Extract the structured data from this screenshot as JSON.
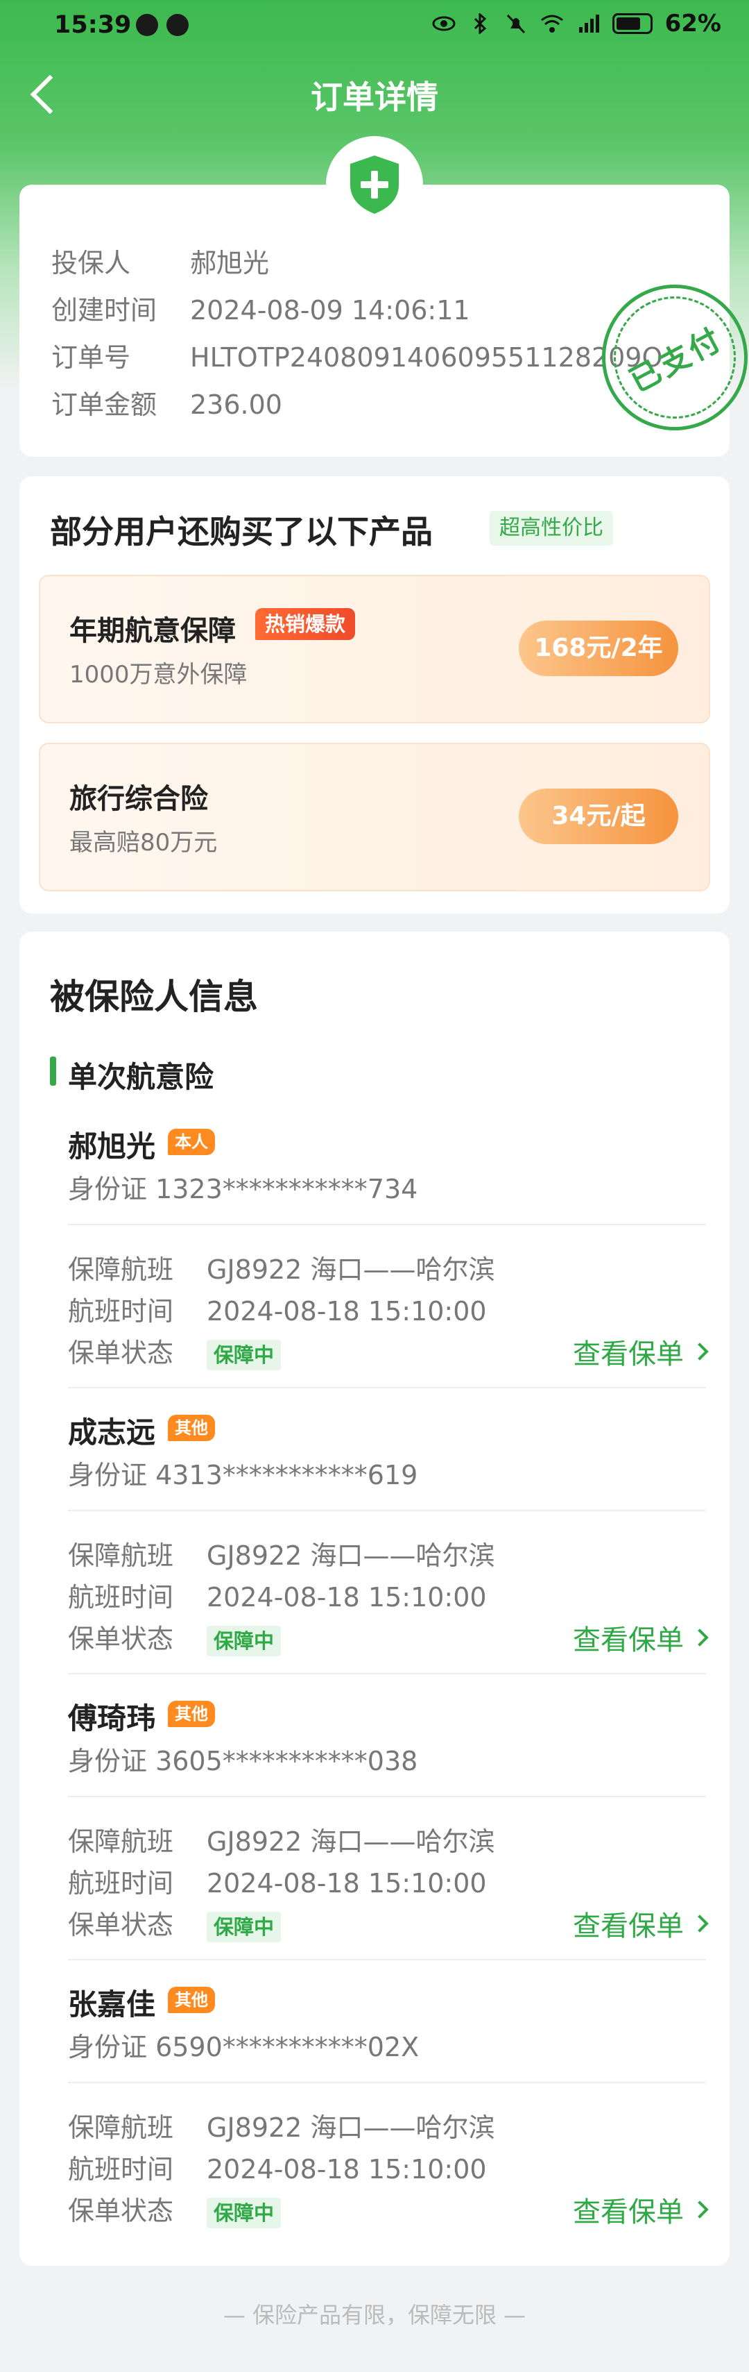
{
  "status_bar": {
    "time": "15:39",
    "battery": "62%"
  },
  "nav": {
    "title": "订单详情"
  },
  "order": {
    "rows": [
      {
        "label": "投保人",
        "value": "郝旭光"
      },
      {
        "label": "创建时间",
        "value": "2024-08-09 14:06:11"
      },
      {
        "label": "订单号",
        "value": "HLTOTP240809140609551128209O"
      },
      {
        "label": "订单金额",
        "value": "236.00"
      }
    ],
    "stamp": "已支付"
  },
  "promo": {
    "title": "部分用户还购买了以下产品",
    "tag": "超高性价比",
    "products": [
      {
        "name": "年期航意保障",
        "badge": "热销爆款",
        "desc": "1000万意外保障",
        "price": "168元/2年"
      },
      {
        "name": "旅行综合险",
        "badge": "",
        "desc": "最高赔80万元",
        "price": "34元/起"
      }
    ]
  },
  "insured": {
    "title": "被保险人信息",
    "subtitle": "单次航意险",
    "labels": {
      "flight": "保障航班",
      "time": "航班时间",
      "status": "保单状态",
      "view": "查看保单"
    },
    "persons": [
      {
        "name": "郝旭光",
        "tag": "本人",
        "id": "身份证 1323***********734",
        "flight": "GJ8922 海口——哈尔滨",
        "time": "2024-08-18 15:10:00",
        "status": "保障中"
      },
      {
        "name": "成志远",
        "tag": "其他",
        "id": "身份证 4313***********619",
        "flight": "GJ8922 海口——哈尔滨",
        "time": "2024-08-18 15:10:00",
        "status": "保障中"
      },
      {
        "name": "傅琦玮",
        "tag": "其他",
        "id": "身份证 3605***********038",
        "flight": "GJ8922 海口——哈尔滨",
        "time": "2024-08-18 15:10:00",
        "status": "保障中"
      },
      {
        "name": "张嘉佳",
        "tag": "其他",
        "id": "身份证 6590***********02X",
        "flight": "GJ8922 海口——哈尔滨",
        "time": "2024-08-18 15:10:00",
        "status": "保障中"
      }
    ]
  },
  "footer": "— 保险产品有限，保障无限 —",
  "colors": {
    "brand": "#35a84a",
    "orange": "#f6933e"
  }
}
